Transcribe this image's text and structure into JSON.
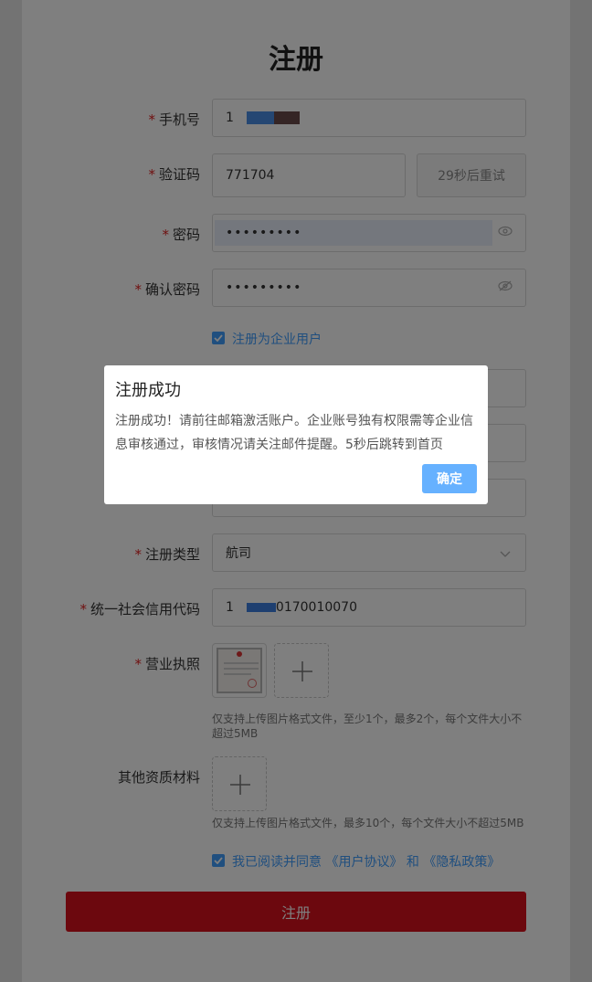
{
  "form": {
    "title": "注册",
    "required_mark": "*",
    "phone": {
      "label": "手机号",
      "value_prefix": "1",
      "value_suffix": ""
    },
    "code": {
      "label": "验证码",
      "value": "771704",
      "resend_label": "29秒后重试"
    },
    "password": {
      "label": "密码",
      "value": "•••••••••"
    },
    "confirm_password": {
      "label": "确认密码",
      "value": "•••••••••"
    },
    "enterprise_checkbox": {
      "label": "注册为企业用户",
      "checked": true
    },
    "register_type": {
      "label": "注册类型",
      "value": "航司"
    },
    "credit_code": {
      "label": "统一社会信用代码",
      "value_prefix": "1",
      "value_suffix": "0170010070"
    },
    "license": {
      "label": "营业执照",
      "hint": "仅支持上传图片格式文件，至少1个，最多2个，每个文件大小不超过5MB"
    },
    "other_materials": {
      "label": "其他资质材料",
      "hint": "仅支持上传图片格式文件，最多10个，每个文件大小不超过5MB"
    },
    "agreement": {
      "prefix": "我已阅读并同意",
      "user_agreement": "《用户协议》",
      "and": "和",
      "privacy_policy": "《隐私政策》",
      "checked": true
    },
    "submit_label": "注册"
  },
  "modal": {
    "title": "注册成功",
    "message": "注册成功！请前往邮箱激活账户。企业账号独有权限需等企业信息审核通过，审核情况请关注邮件提醒。5秒后跳转到首页",
    "ok_label": "确定"
  },
  "colors": {
    "primary": "#409eff",
    "danger": "#d8101c",
    "required": "#e02020"
  },
  "icons": [
    "eye-icon",
    "chevron-down-icon",
    "plus-icon",
    "check-icon"
  ]
}
